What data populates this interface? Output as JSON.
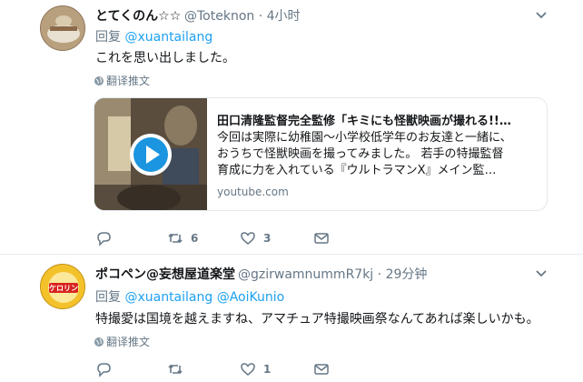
{
  "tweets": [
    {
      "name": "とてくのん☆☆",
      "handle": "@Toteknon",
      "time": "4小时",
      "reply_prefix": "回复",
      "reply_to": "@xuantailang",
      "text": "これを思い出しました。",
      "translate": "翻译推文",
      "card": {
        "title": "田口清隆監督完全監修「キミにも怪獣映画が撮れる!!…",
        "desc": [
          "今回は実際に幼稚園～小学校低学年のお友達と一緒に、",
          "おうちで怪獣映画を撮ってみました。 若手の特撮監督",
          "育成に力を入れている『ウルトラマンX』メイン監…"
        ],
        "source": "youtube.com"
      },
      "actions": {
        "reply": "",
        "retweet": "6",
        "like": "3"
      }
    },
    {
      "name": "ポコペン@妄想屋道楽堂",
      "handle": "@gzirwamnummR7kj",
      "time": "29分钟",
      "reply_prefix": "回复",
      "reply_to": "@xuantailang @AoiKunio",
      "text": "特撮愛は国境を越えますね、アマチュア特撮映画祭なんてあれば楽しいかも。",
      "translate": "翻译推文",
      "avatar_text": "ケロリン",
      "actions": {
        "reply": "",
        "retweet": "",
        "like": "1"
      }
    }
  ],
  "colors": {
    "link": "#1da1f2",
    "muted": "#657786",
    "text": "#14171a",
    "play": "#1b95e0"
  },
  "icons": [
    "chevron-down-icon",
    "globe-icon",
    "reply-icon",
    "retweet-icon",
    "like-icon",
    "message-icon",
    "play-icon"
  ]
}
